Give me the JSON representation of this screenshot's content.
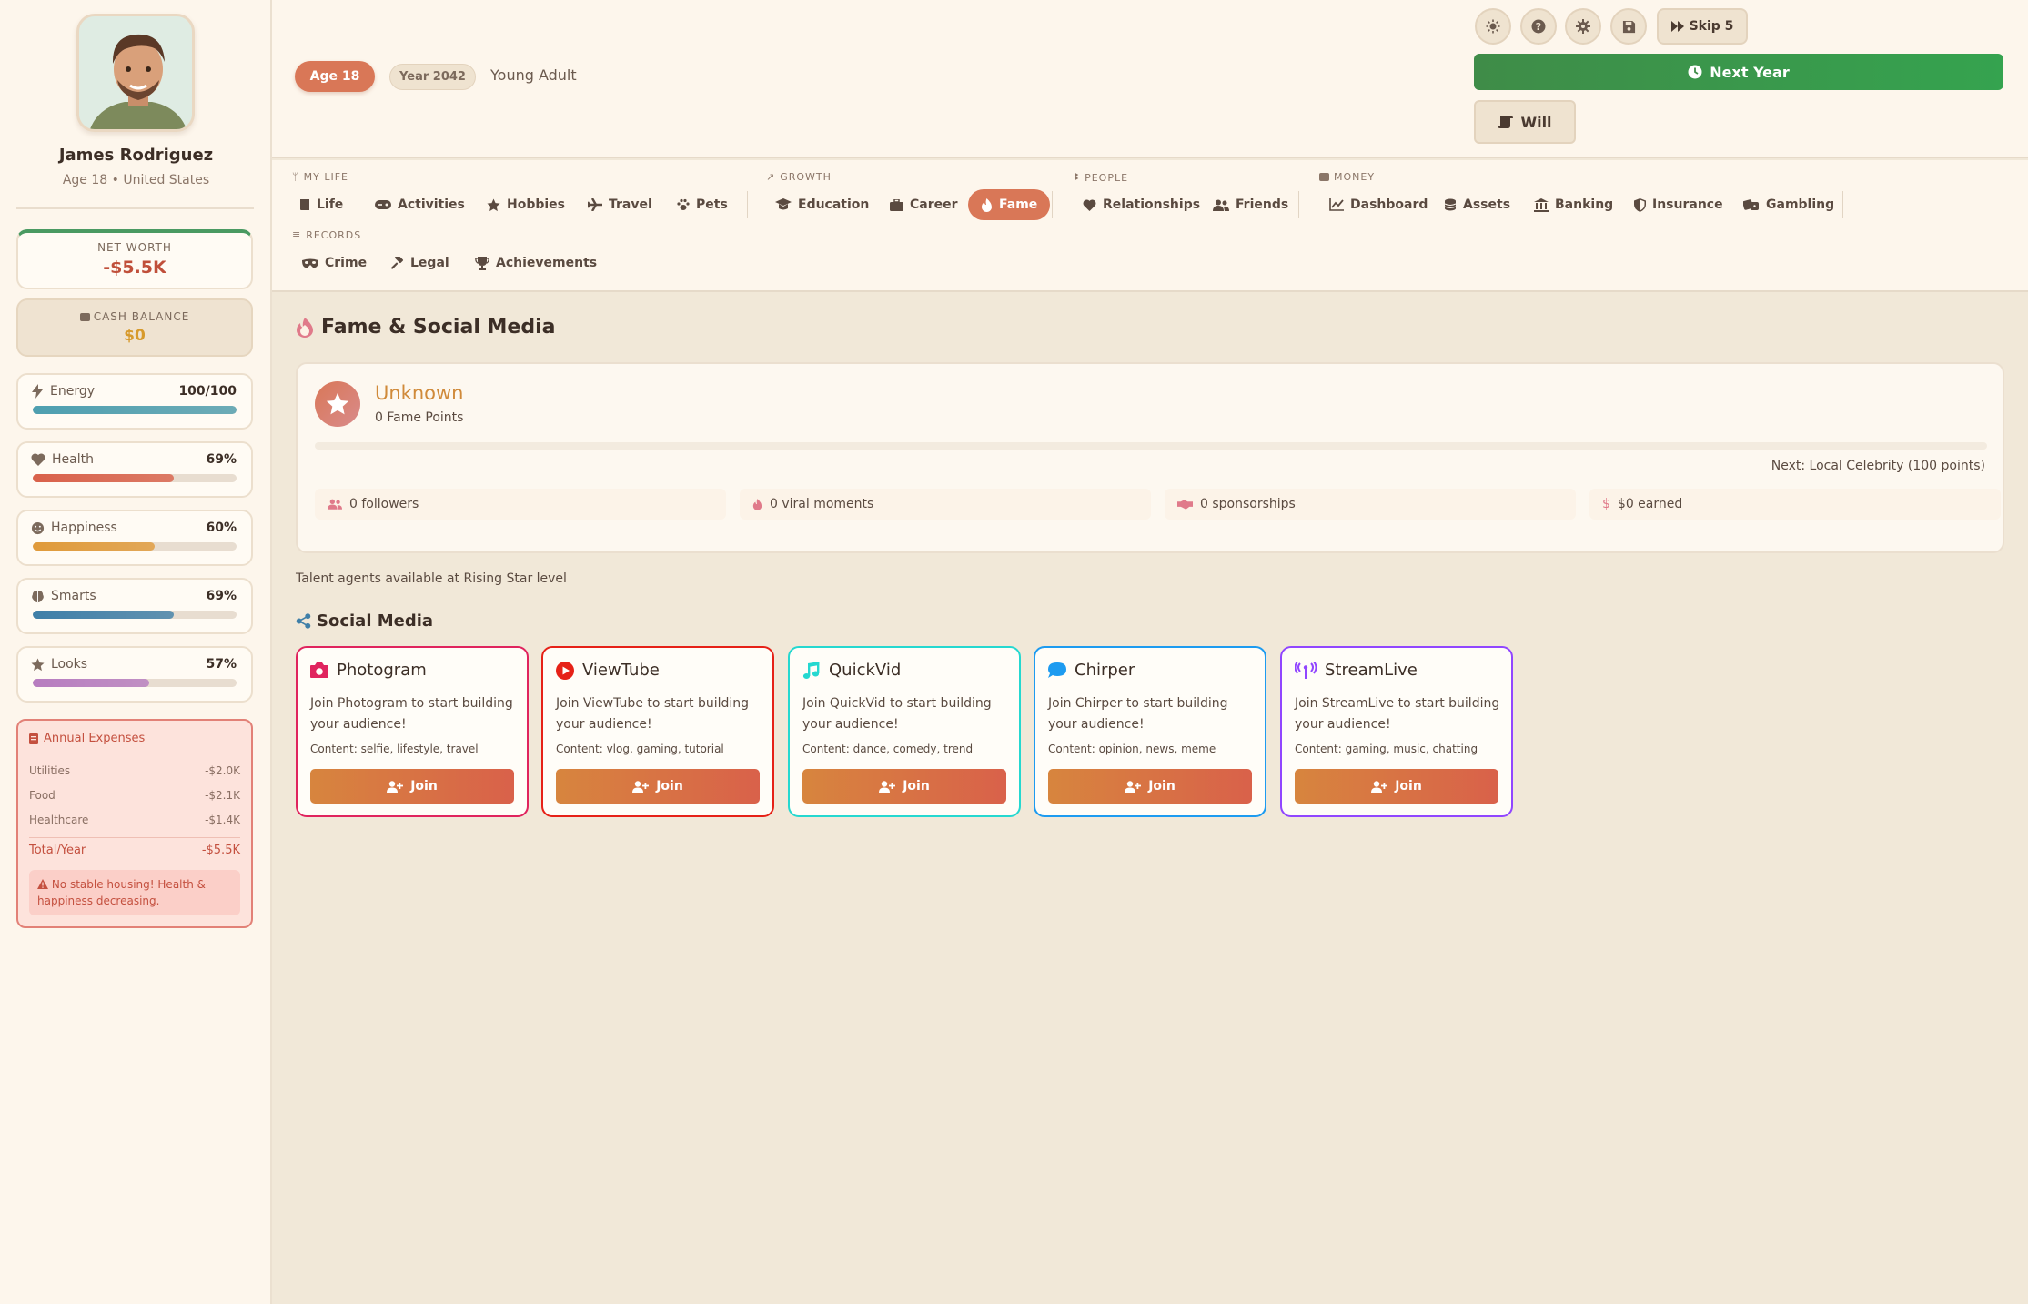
{
  "profile": {
    "name": "James Rodriguez",
    "meta": "Age 18 • United States"
  },
  "finance": {
    "net_worth_label": "NET WORTH",
    "net_worth": "-$5.5K",
    "cash_label": "CASH BALANCE",
    "cash": "$0"
  },
  "stats": [
    {
      "label": "Energy",
      "value": "100/100",
      "level": 1.0,
      "color": "#4e9fb0",
      "icon": "lightning-icon"
    },
    {
      "label": "Health",
      "value": "69%",
      "level": 0.69,
      "color": "#d9614a",
      "icon": "heart-icon"
    },
    {
      "label": "Happiness",
      "value": "60%",
      "level": 0.6,
      "color": "#e09a3a",
      "icon": "smile-icon"
    },
    {
      "label": "Smarts",
      "value": "69%",
      "level": 0.69,
      "color": "#3f7fa8",
      "icon": "brain-icon"
    },
    {
      "label": "Looks",
      "value": "57%",
      "level": 0.57,
      "color": "#b77cc0",
      "icon": "star-icon"
    }
  ],
  "expenses": {
    "title": "Annual Expenses",
    "items": [
      {
        "label": "Utilities",
        "value": "-$2.0K"
      },
      {
        "label": "Food",
        "value": "-$2.1K"
      },
      {
        "label": "Healthcare",
        "value": "-$1.4K"
      }
    ],
    "total_label": "Total/Year",
    "total": "-$5.5K",
    "warning": "No stable housing! Health & happiness decreasing."
  },
  "header": {
    "age": "Age 18",
    "year": "Year 2042",
    "stage": "Young Adult",
    "skip_label": "Skip 5",
    "next_year_label": "Next Year",
    "will_label": "Will"
  },
  "nav": {
    "groups": {
      "my_life": "MY LIFE",
      "growth": "GROWTH",
      "people": "PEOPLE",
      "money": "MONEY",
      "records": "RECORDS"
    },
    "items": {
      "life": "Life",
      "activities": "Activities",
      "hobbies": "Hobbies",
      "travel": "Travel",
      "pets": "Pets",
      "education": "Education",
      "career": "Career",
      "fame": "Fame",
      "relationships": "Relationships",
      "friends": "Friends",
      "dashboard": "Dashboard",
      "assets": "Assets",
      "banking": "Banking",
      "insurance": "Insurance",
      "gambling": "Gambling",
      "crime": "Crime",
      "legal": "Legal",
      "achievements": "Achievements"
    },
    "active": "Fame"
  },
  "fame": {
    "page_title": "Fame & Social Media",
    "level": "Unknown",
    "points": "0 Fame Points",
    "progress": 0,
    "next_level": "Next: Local Celebrity (100 points)",
    "followers": "0 followers",
    "viral": "0 viral moments",
    "sponsorships": "0 sponsorships",
    "earned": "$0 earned",
    "talent_note": "Talent agents available at Rising Star level"
  },
  "social_media": {
    "title": "Social Media",
    "join_label": "Join",
    "platforms": [
      {
        "name": "Photogram",
        "desc": "Join Photogram to start building your audience!",
        "content": "Content: selfie, lifestyle, travel",
        "color": "#e0245e",
        "icon": "camera-icon"
      },
      {
        "name": "ViewTube",
        "desc": "Join ViewTube to start building your audience!",
        "content": "Content: vlog, gaming, tutorial",
        "color": "#e62117",
        "icon": "play-icon"
      },
      {
        "name": "QuickVid",
        "desc": "Join QuickVid to start building your audience!",
        "content": "Content: dance, comedy, trend",
        "color": "#25d8d0",
        "icon": "music-note-icon"
      },
      {
        "name": "Chirper",
        "desc": "Join Chirper to start building your audience!",
        "content": "Content: opinion, news, meme",
        "color": "#1d9bf0",
        "icon": "speech-bubble-icon"
      },
      {
        "name": "StreamLive",
        "desc": "Join StreamLive to start building your audience!",
        "content": "Content: gaming, music, chatting",
        "color": "#9146ff",
        "icon": "broadcast-icon"
      }
    ]
  }
}
